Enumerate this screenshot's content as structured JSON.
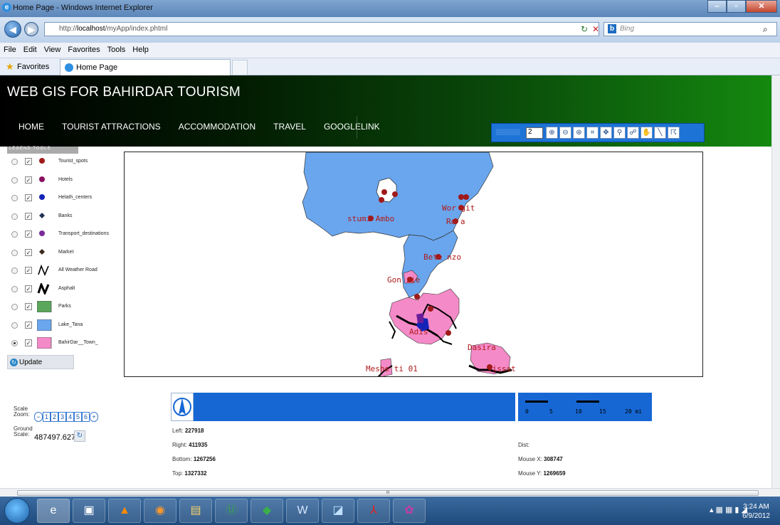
{
  "window": {
    "title": "Home Page - Windows Internet Explorer",
    "min": "–",
    "max": "▫",
    "close": "✕"
  },
  "address": {
    "url_prefix": "http://",
    "url_host": "localhost",
    "url_path": "/myApp/index.phtml",
    "search_placeholder": "Bing"
  },
  "menu": [
    "File",
    "Edit",
    "View",
    "Favorites",
    "Tools",
    "Help"
  ],
  "favorites": {
    "label": "Favorites",
    "tab": "Home Page"
  },
  "site": {
    "title": "WEB GIS FOR BAHIRDAR TOURISM",
    "nav": [
      "HOME",
      "TOURIST ATTRACTIONS",
      "ACCOMMODATION",
      "TRAVEL",
      "GOOGLELINK"
    ]
  },
  "toolbar": {
    "zoom_value": "2"
  },
  "legend": {
    "header": "LEGEND  TOOLS",
    "items": [
      {
        "label": "Tourist_spots",
        "symbol": "dot",
        "color": "#a01a1a",
        "checked": true
      },
      {
        "label": "Hotels",
        "symbol": "dot",
        "color": "#8a1060",
        "checked": true
      },
      {
        "label": "Helath_centers",
        "symbol": "dot",
        "color": "#1424b8",
        "checked": true
      },
      {
        "label": "Banks",
        "symbol": "diamond",
        "color": "#223355",
        "checked": true
      },
      {
        "label": "Transport_destinations",
        "symbol": "dot",
        "color": "#7a2a9a",
        "checked": true
      },
      {
        "label": "Market",
        "symbol": "diamond",
        "color": "#3a2a1a",
        "checked": true
      },
      {
        "label": "All Weather Road",
        "symbol": "line-thin",
        "color": "#000000",
        "checked": true
      },
      {
        "label": "Asphalt",
        "symbol": "line-thick",
        "color": "#000000",
        "checked": true
      },
      {
        "label": "Parks",
        "symbol": "box",
        "color": "#5aa65a",
        "checked": true
      },
      {
        "label": "Lake_Tana",
        "symbol": "box",
        "color": "#6aa6ee",
        "checked": true
      },
      {
        "label": "BahirDar__Town_",
        "symbol": "box",
        "color": "#f58ac8",
        "checked": true
      }
    ],
    "update_label": "Update"
  },
  "map": {
    "labels": [
      "stumi Ambo",
      "Wor  git",
      "Ro  a",
      "Bete  nzo",
      "Gon  zie",
      "Adis",
      "Dasira",
      "Tissat",
      "Meshe ti 01"
    ],
    "colors": {
      "lake": "#6aa6ee",
      "town": "#f58ac8",
      "point": "#a01a1a",
      "road": "#000000",
      "label": "#b01a1a"
    }
  },
  "bottom": {
    "scale_label": "Scale",
    "zoom_label": "Zoom:",
    "zoom_levels": [
      "1",
      "2",
      "3",
      "4",
      "5",
      "6"
    ],
    "ground_label": "Ground",
    "scale2_label": "Scale:",
    "ground_value": "487497.6271",
    "scalebar_labels": [
      "0",
      "5",
      "10",
      "15",
      "20 mi"
    ],
    "left_label": "Left:",
    "left_value": "227918",
    "right_label": "Right:",
    "right_value": "411935",
    "bottom_label": "Bottom:",
    "bottom_value": "1267256",
    "top_label": "Top:",
    "top_value": "1327332",
    "dist_label": "Dist:",
    "mousex_label": "Mouse X:",
    "mousex_value": "308747",
    "mousey_label": "Mouse Y:",
    "mousey_value": "1269659"
  },
  "scroll_thumb": "III",
  "taskbar": {
    "time": "3:24 AM",
    "date": "6/9/2012"
  }
}
